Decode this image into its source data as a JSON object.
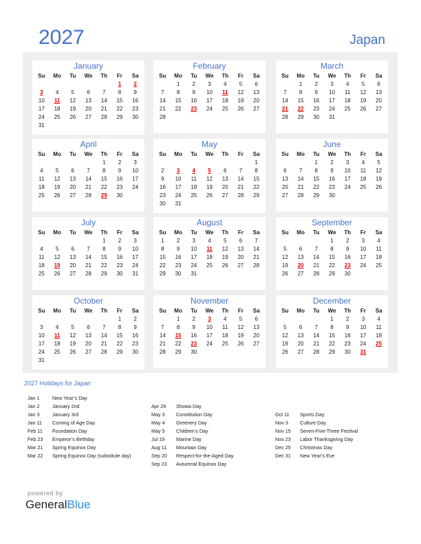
{
  "header": {
    "year": "2027",
    "country": "Japan"
  },
  "weekdays": [
    "Su",
    "Mo",
    "Tu",
    "We",
    "Th",
    "Fr",
    "Sa"
  ],
  "months": [
    {
      "name": "January",
      "start": 5,
      "days": 31,
      "holidays": [
        1,
        2,
        3,
        11
      ]
    },
    {
      "name": "February",
      "start": 1,
      "days": 28,
      "holidays": [
        11,
        23
      ]
    },
    {
      "name": "March",
      "start": 1,
      "days": 31,
      "holidays": [
        21,
        22
      ]
    },
    {
      "name": "April",
      "start": 4,
      "days": 30,
      "holidays": [
        29
      ]
    },
    {
      "name": "May",
      "start": 6,
      "days": 31,
      "holidays": [
        3,
        4,
        5
      ]
    },
    {
      "name": "June",
      "start": 2,
      "days": 30,
      "holidays": []
    },
    {
      "name": "July",
      "start": 4,
      "days": 31,
      "holidays": [
        19
      ]
    },
    {
      "name": "August",
      "start": 0,
      "days": 31,
      "holidays": [
        11
      ]
    },
    {
      "name": "September",
      "start": 3,
      "days": 30,
      "holidays": [
        20,
        23
      ]
    },
    {
      "name": "October",
      "start": 5,
      "days": 31,
      "holidays": [
        11
      ]
    },
    {
      "name": "November",
      "start": 1,
      "days": 30,
      "holidays": [
        3,
        15,
        23
      ]
    },
    {
      "name": "December",
      "start": 3,
      "days": 31,
      "holidays": [
        25,
        31
      ]
    }
  ],
  "holidays_title": "2027 Holidays for Japan",
  "holiday_columns": [
    [
      {
        "date": "Jan 1",
        "name": "New Year’s Day"
      },
      {
        "date": "Jan 2",
        "name": "January 2nd"
      },
      {
        "date": "Jan 3",
        "name": "January 3rd"
      },
      {
        "date": "Jan 11",
        "name": "Coming of Age Day"
      },
      {
        "date": "Feb 11",
        "name": "Foundation Day"
      },
      {
        "date": "Feb 23",
        "name": "Emperor’s Birthday"
      },
      {
        "date": "Mar 21",
        "name": "Spring Equinox Day"
      },
      {
        "date": "Mar 22",
        "name": "Spring Equinox Day (substitute day)"
      }
    ],
    [
      {
        "date": "Apr 29",
        "name": "Showa Day"
      },
      {
        "date": "May 3",
        "name": "Constitution Day"
      },
      {
        "date": "May 4",
        "name": "Greenery Day"
      },
      {
        "date": "May 5",
        "name": "Children’s Day"
      },
      {
        "date": "Jul 19",
        "name": "Marine Day"
      },
      {
        "date": "Aug 11",
        "name": "Mountain Day"
      },
      {
        "date": "Sep 20",
        "name": "Respect-for-the-Aged Day"
      },
      {
        "date": "Sep 23",
        "name": "Autumnal Equinox Day"
      }
    ],
    [
      {
        "date": "Oct 11",
        "name": "Sports Day"
      },
      {
        "date": "Nov 3",
        "name": "Culture Day"
      },
      {
        "date": "Nov 15",
        "name": "Seven-Five-Three Festival"
      },
      {
        "date": "Nov 23",
        "name": "Labor Thanksgiving Day"
      },
      {
        "date": "Dec 25",
        "name": "Christmas Day"
      },
      {
        "date": "Dec 31",
        "name": "New Year’s Eve"
      }
    ]
  ],
  "footer": {
    "powered_by": "powered by",
    "brand_part1": "General",
    "brand_part2": "Blue"
  },
  "colors": {
    "accent": "#4472c4",
    "holiday": "#e00000",
    "panel": "#efefef",
    "brand_blue": "#2b8fd6"
  }
}
